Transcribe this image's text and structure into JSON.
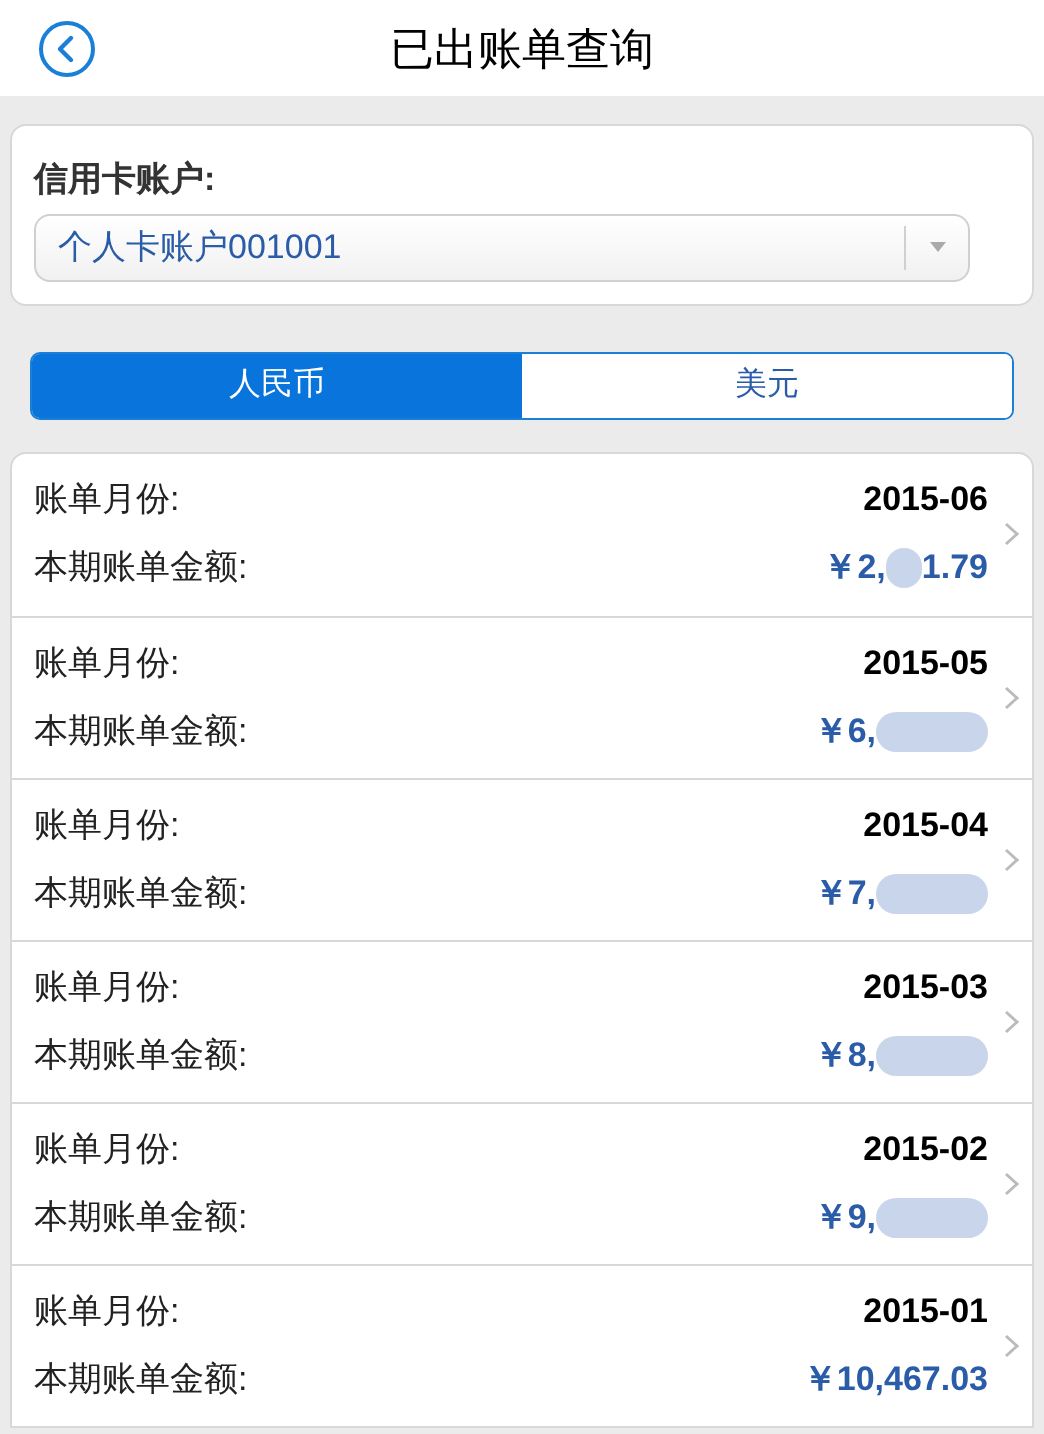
{
  "header": {
    "title": "已出账单查询"
  },
  "account": {
    "label": "信用卡账户:",
    "value": "个人卡账户001001"
  },
  "tabs": [
    {
      "label": "人民币",
      "selected": true
    },
    {
      "label": "美元",
      "selected": false
    }
  ],
  "bills": [
    {
      "month_label": "账单月份:",
      "month": "2015-06",
      "amount_label": "本期账单金额:",
      "amount": "￥2,",
      "amount_tail": "1.79",
      "redacted": true
    },
    {
      "month_label": "账单月份:",
      "month": "2015-05",
      "amount_label": "本期账单金额:",
      "amount": "￥6,",
      "redacted": true
    },
    {
      "month_label": "账单月份:",
      "month": "2015-04",
      "amount_label": "本期账单金额:",
      "amount": "￥7,",
      "redacted": true
    },
    {
      "month_label": "账单月份:",
      "month": "2015-03",
      "amount_label": "本期账单金额:",
      "amount": "￥8,",
      "redacted": true
    },
    {
      "month_label": "账单月份:",
      "month": "2015-02",
      "amount_label": "本期账单金额:",
      "amount": "￥9,",
      "redacted": true
    },
    {
      "month_label": "账单月份:",
      "month": "2015-01",
      "amount_label": "本期账单金额:",
      "amount": "￥10,467.03",
      "redacted": false
    }
  ]
}
